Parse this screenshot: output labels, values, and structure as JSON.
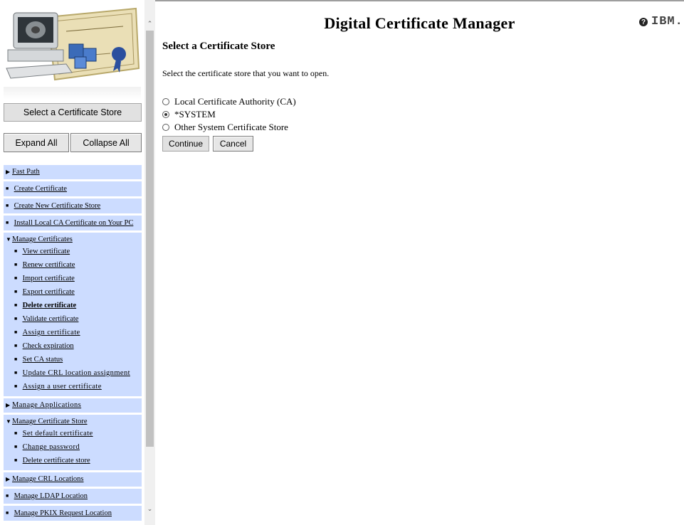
{
  "nav": {
    "store_button": "Select a Certificate Store",
    "expand_all": "Expand All",
    "collapse_all": "Collapse All",
    "menu": [
      {
        "label": "Fast Path",
        "marker": "collapsed"
      },
      {
        "label": "Create Certificate",
        "marker": "bullet"
      },
      {
        "label": "Create New Certificate Store",
        "marker": "bullet"
      },
      {
        "label": "Install Local CA Certificate on Your PC",
        "marker": "bullet"
      },
      {
        "label": "Manage Certificates",
        "marker": "expanded",
        "children": [
          "View certificate",
          "Renew certificate",
          "Import certificate",
          "Export certificate",
          "Delete certificate",
          "Validate certificate",
          "Assign certificate",
          "Check expiration",
          "Set CA status",
          "Update CRL location assignment",
          "Assign a user certificate"
        ]
      },
      {
        "label": "Manage Applications",
        "marker": "collapsed"
      },
      {
        "label": "Manage Certificate Store",
        "marker": "expanded",
        "children": [
          "Set default certificate",
          "Change password",
          "Delete certificate store"
        ]
      },
      {
        "label": "Manage CRL Locations",
        "marker": "collapsed"
      },
      {
        "label": "Manage LDAP Location",
        "marker": "bullet"
      },
      {
        "label": "Manage PKIX Request Location",
        "marker": "bullet"
      }
    ]
  },
  "header": {
    "title": "Digital Certificate Manager",
    "help_glyph": "?",
    "logo_text": "IBM."
  },
  "main": {
    "heading": "Select a Certificate Store",
    "instructions": "Select the certificate store that you want to open.",
    "options": [
      {
        "label": "Local Certificate Authority (CA)",
        "selected": false
      },
      {
        "label": "*SYSTEM",
        "selected": true
      },
      {
        "label": "Other System Certificate Store",
        "selected": false
      }
    ],
    "continue_label": "Continue",
    "cancel_label": "Cancel"
  },
  "colors": {
    "menu_background": "#ccdcff",
    "header_rule": "#9e9e9e"
  }
}
